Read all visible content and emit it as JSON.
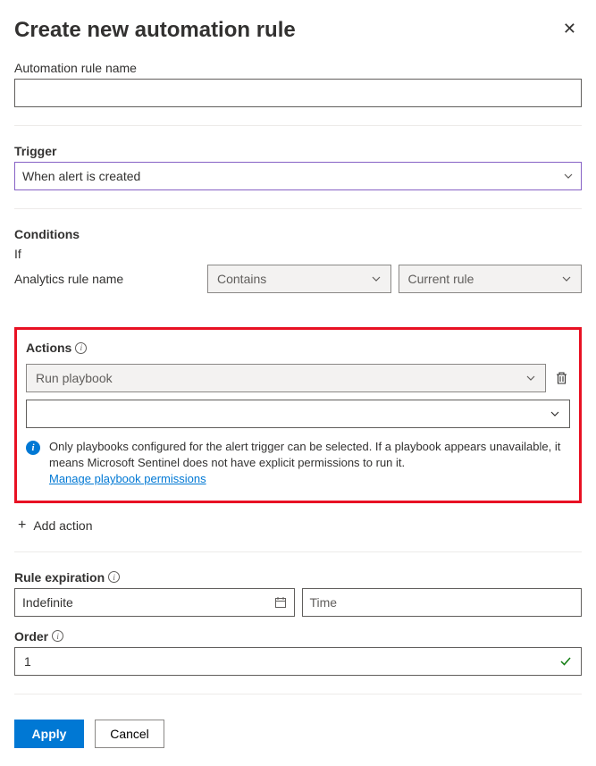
{
  "header": {
    "title": "Create new automation rule"
  },
  "name": {
    "label": "Automation rule name",
    "value": ""
  },
  "trigger": {
    "label": "Trigger",
    "value": "When alert is created"
  },
  "conditions": {
    "label": "Conditions",
    "if_label": "If",
    "field_label": "Analytics rule name",
    "op_value": "Contains",
    "val_value": "Current rule"
  },
  "actions": {
    "label": "Actions",
    "playbook_value": "Run playbook",
    "info_text": "Only playbooks configured for the alert trigger can be selected. If a playbook appears unavailable, it means Microsoft Sentinel does not have explicit permissions to run it.",
    "manage_link": "Manage playbook permissions",
    "add_label": "Add action"
  },
  "expiration": {
    "label": "Rule expiration",
    "date_value": "Indefinite",
    "time_placeholder": "Time"
  },
  "order": {
    "label": "Order",
    "value": "1"
  },
  "footer": {
    "apply": "Apply",
    "cancel": "Cancel"
  }
}
